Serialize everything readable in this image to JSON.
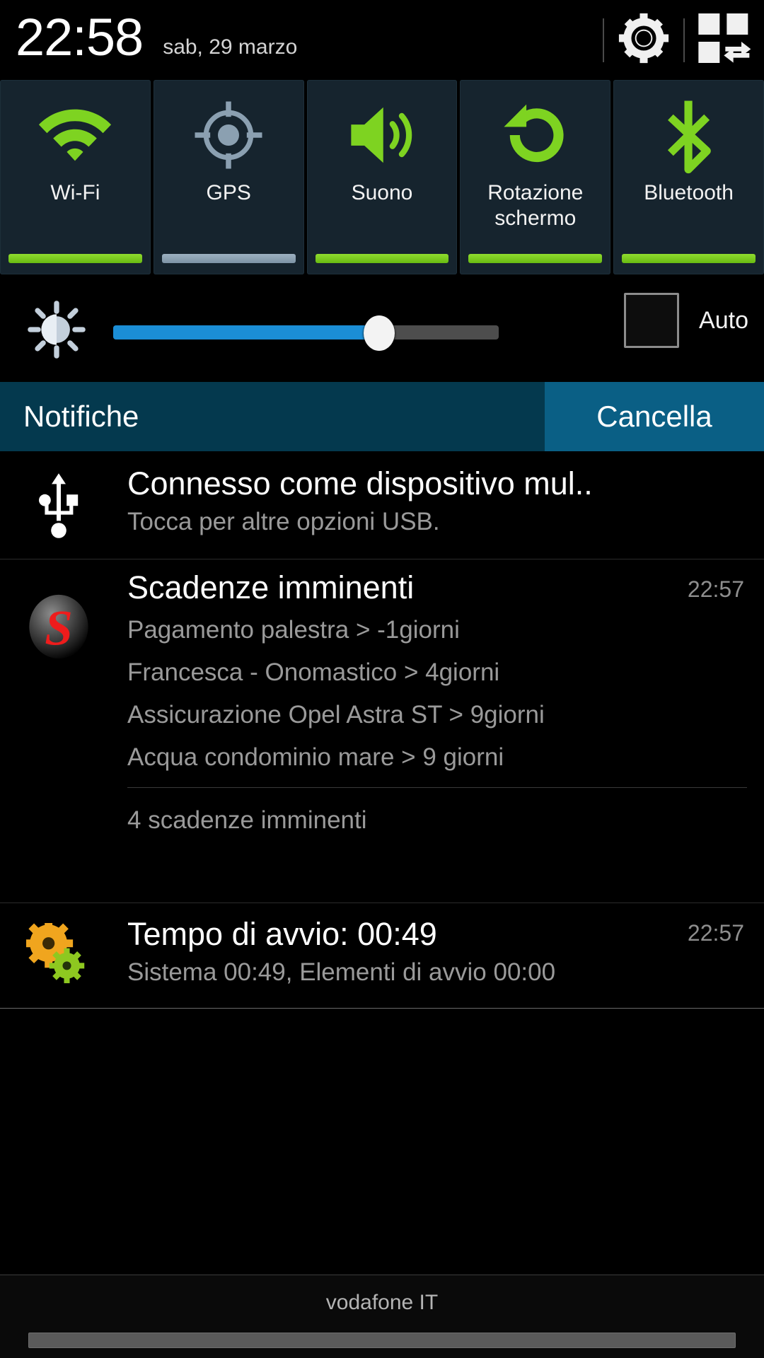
{
  "statusbar": {
    "time": "22:58",
    "date": "sab, 29 marzo",
    "settings_icon": "gear-icon",
    "quick_panel_icon": "quick-settings-grid-icon"
  },
  "quick_toggles": [
    {
      "label": "Wi-Fi",
      "icon": "wifi-icon",
      "state": "on",
      "color": "#7ed321"
    },
    {
      "label": "GPS",
      "icon": "gps-target-icon",
      "state": "off",
      "color": "#8ba0b1"
    },
    {
      "label": "Suono",
      "icon": "volume-speaker-icon",
      "state": "on",
      "color": "#7ed321"
    },
    {
      "label": "Rotazione schermo",
      "icon": "screen-rotation-icon",
      "state": "on",
      "color": "#7ed321"
    },
    {
      "label": "Bluetooth",
      "icon": "bluetooth-icon",
      "state": "on",
      "color": "#7ed321"
    }
  ],
  "brightness": {
    "icon": "brightness-sun-icon",
    "value_percent": 69,
    "auto_label": "Auto",
    "auto_checked": false,
    "fill_color": "#1b8ed6"
  },
  "notifications_header": {
    "title": "Notifiche",
    "clear_label": "Cancella",
    "bar_color": "#04394e",
    "clear_color": "#0a5f85"
  },
  "notifications": [
    {
      "icon": "usb-icon",
      "title": "Connesso come dispositivo mul..",
      "subtitle": "Tocca per altre opzioni USB.",
      "time": ""
    },
    {
      "icon": "app-s-badge-icon",
      "title": "Scadenze imminenti",
      "time": "22:57",
      "lines": [
        "Pagamento palestra >  -1giorni",
        "Francesca - Onomastico > 4giorni",
        "Assicurazione Opel Astra ST > 9giorni",
        "Acqua condominio mare > 9 giorni"
      ],
      "summary": "4 scadenze imminenti"
    },
    {
      "icon": "gears-icon",
      "title": "Tempo di avvio: 00:49",
      "subtitle": "Sistema 00:49, Elementi di avvio 00:00",
      "time": "22:57"
    }
  ],
  "footer": {
    "carrier": "vodafone IT",
    "handle": "drag-handle"
  }
}
